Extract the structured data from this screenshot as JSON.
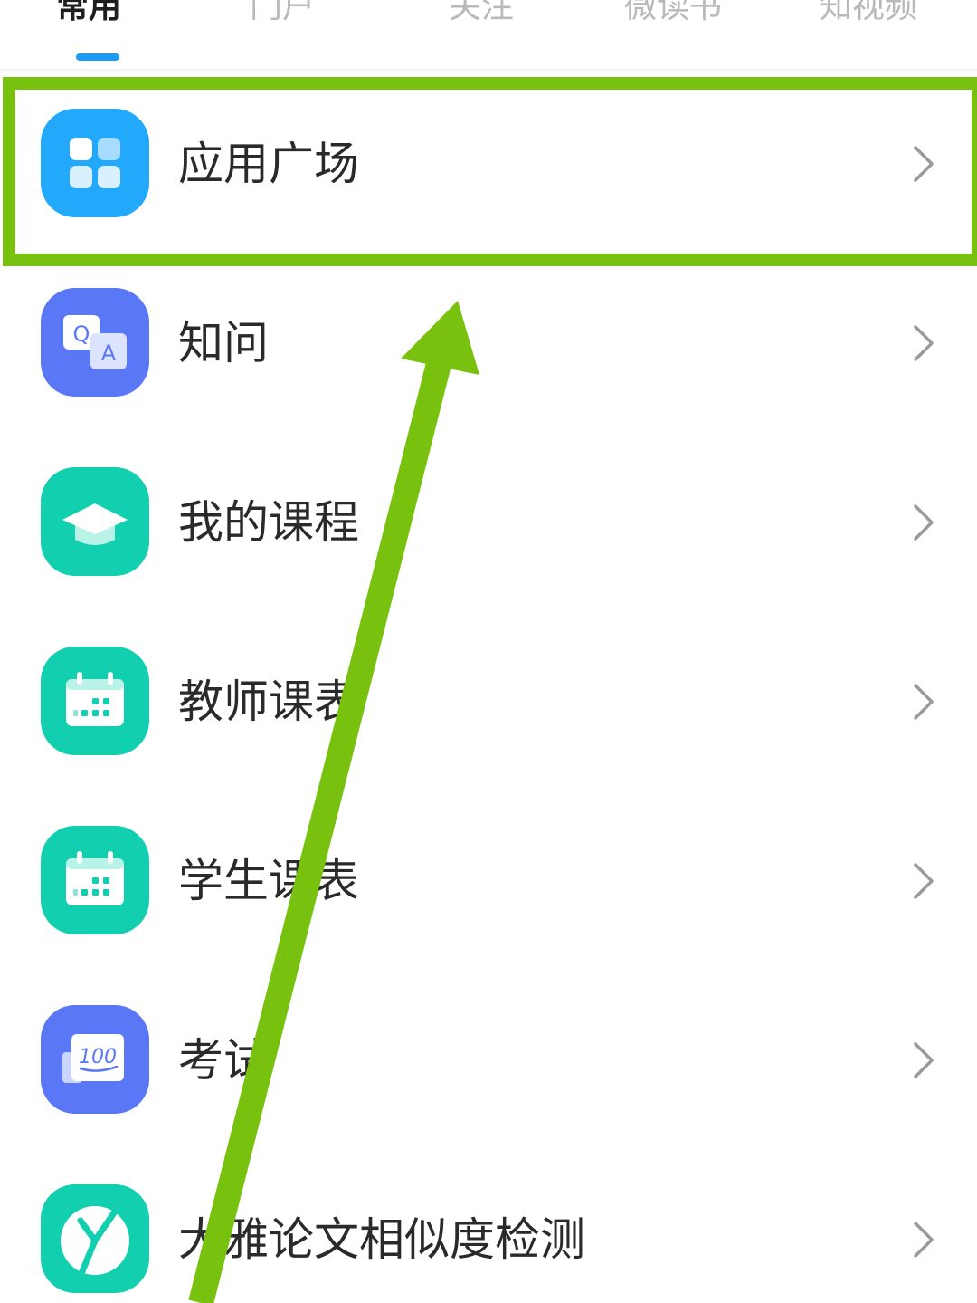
{
  "tabs": [
    {
      "label": "常用",
      "active": true
    },
    {
      "label": "门户",
      "active": false
    },
    {
      "label": "关注",
      "active": false
    },
    {
      "label": "微读书",
      "active": false
    },
    {
      "label": "知视频",
      "active": false
    }
  ],
  "accent_color": "#1a9cf5",
  "annotation_color": "#78c20f",
  "list": [
    {
      "label": "应用广场",
      "icon": "app-square-icon",
      "icon_color": "#23a9fb"
    },
    {
      "label": "知问",
      "icon": "qa-icon",
      "icon_color": "#5a78f6"
    },
    {
      "label": "我的课程",
      "icon": "graduation-cap-icon",
      "icon_color": "#12cfb0"
    },
    {
      "label": "教师课表",
      "icon": "calendar-icon",
      "icon_color": "#12cfb0"
    },
    {
      "label": "学生课表",
      "icon": "calendar-icon",
      "icon_color": "#12cfb0"
    },
    {
      "label": "考试",
      "icon": "exam-score-icon",
      "icon_color": "#5a78f6"
    },
    {
      "label": "大雅论文相似度检测",
      "icon": "daya-logo-icon",
      "icon_color": "#12cfb0"
    }
  ],
  "icon_text": {
    "qa_q": "Q",
    "qa_a": "A",
    "exam_score": "100"
  }
}
